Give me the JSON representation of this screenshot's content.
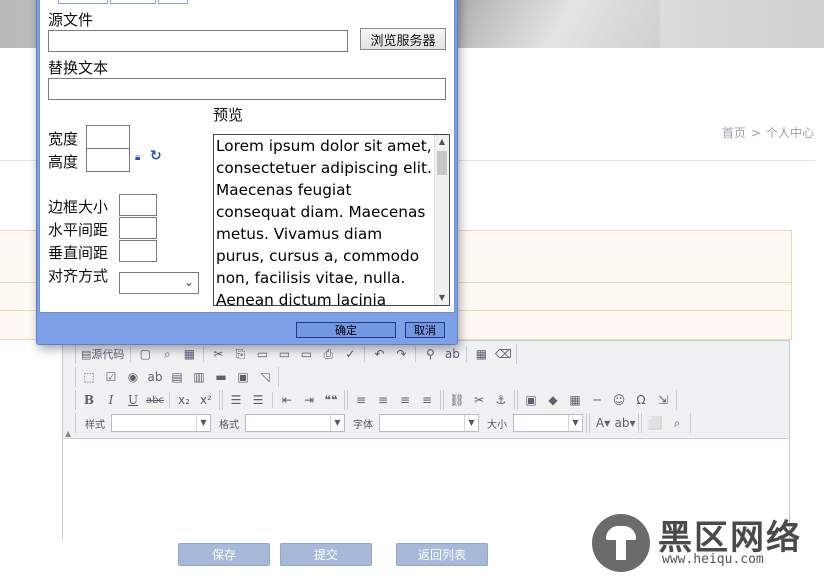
{
  "breadcrumb": {
    "home": "首页",
    "separator": ">",
    "current": "个人中心"
  },
  "dialog": {
    "source_label": "源文件",
    "source_value": "",
    "browse_button": "浏览服务器",
    "alt_label": "替换文本",
    "alt_value": "",
    "width_label": "宽度",
    "height_label": "高度",
    "lock_icon": "lock-icon",
    "reset_icon": "reset-size-icon",
    "border_label": "边框大小",
    "hspace_label": "水平间距",
    "vspace_label": "垂直间距",
    "align_label": "对齐方式",
    "align_value": "",
    "preview_label": "预览",
    "preview_text": "Lorem ipsum dolor sit amet, consectetuer adipiscing elit. Maecenas feugiat consequat diam. Maecenas metus. Vivamus diam purus, cursus a, commodo non, facilisis vitae, nulla. Aenean dictum lacinia tortor. Nunc",
    "ok_button": "确定",
    "cancel_button": "取消"
  },
  "editor": {
    "row1": {
      "source": "源代码"
    },
    "row3": {
      "bold": "B",
      "italic": "I",
      "underline": "U",
      "strike": "abc",
      "subscript": "x₂",
      "superscript": "x²",
      "quote": "❝❝"
    },
    "row4": {
      "style_label": "样式",
      "format_label": "格式",
      "font_label": "字体",
      "size_label": "大小"
    },
    "content": ""
  },
  "actions": {
    "save": "保存",
    "submit": "提交",
    "back": "返回列表"
  },
  "watermark": {
    "title": "黑区网络",
    "url": "www.heiqu.com"
  },
  "colors": {
    "dialog_frame": "#7da0e6",
    "button_blue": "#a7b9d9",
    "peach_border": "#f0d7bc"
  }
}
